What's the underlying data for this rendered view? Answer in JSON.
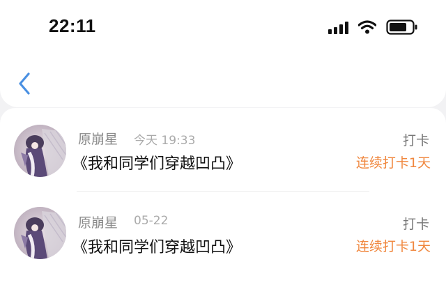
{
  "status_bar": {
    "time": "22:11",
    "signal_icon": "cellular-signal-icon",
    "wifi_icon": "wifi-icon",
    "battery_icon": "battery-icon"
  },
  "nav": {
    "back_icon": "chevron-left-icon",
    "accent_color": "#4a90e2"
  },
  "colors": {
    "streak": "#f0873e",
    "name": "#888888",
    "title": "#111111"
  },
  "records": [
    {
      "name": "原崩星",
      "date": "今天 19:33",
      "title": "《我和同学们穿越凹凸》",
      "action": "打卡",
      "streak": "连续打卡1天"
    },
    {
      "name": "原崩星",
      "date": "05-22",
      "title": "《我和同学们穿越凹凸》",
      "action": "打卡",
      "streak": "连续打卡1天"
    }
  ]
}
